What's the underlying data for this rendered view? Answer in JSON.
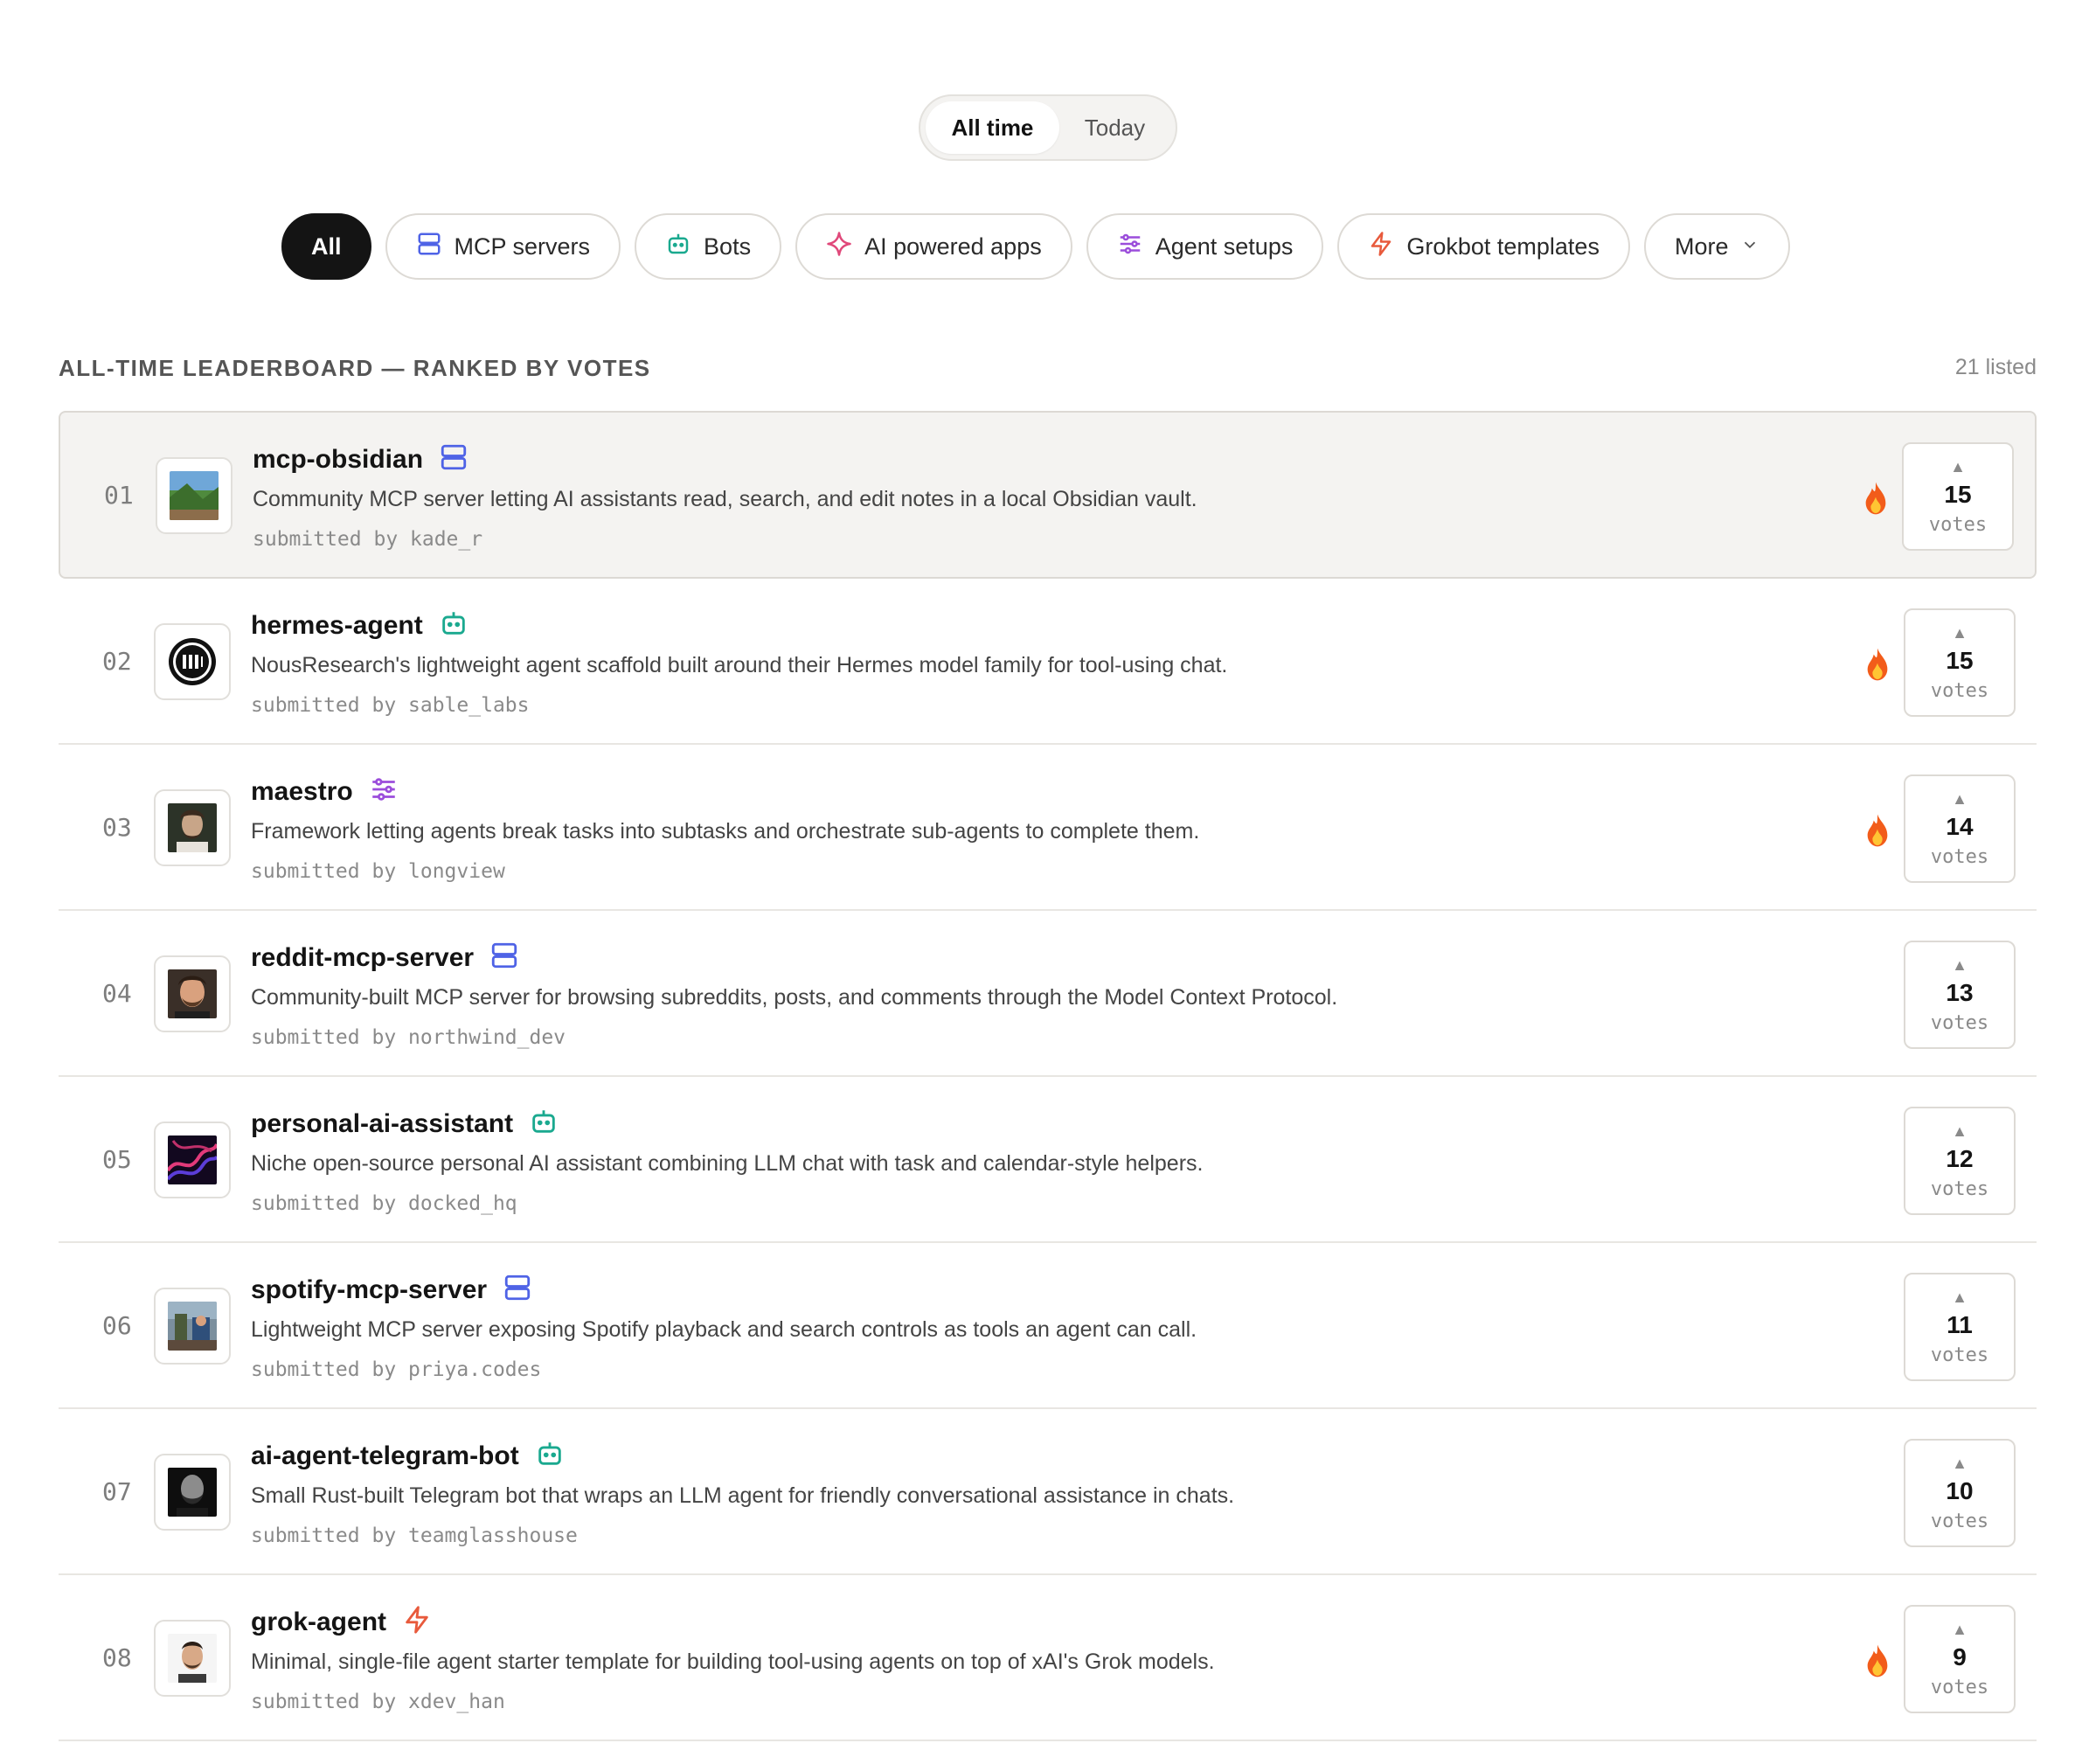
{
  "time_toggle": {
    "options": [
      "All time",
      "Today"
    ],
    "active": "All time"
  },
  "filters": [
    {
      "label": "All",
      "icon": "none",
      "active": true
    },
    {
      "label": "MCP servers",
      "icon": "server-icon"
    },
    {
      "label": "Bots",
      "icon": "bot-icon"
    },
    {
      "label": "AI powered apps",
      "icon": "sparkle-icon"
    },
    {
      "label": "Agent setups",
      "icon": "sliders-icon"
    },
    {
      "label": "Grokbot templates",
      "icon": "bolt-icon"
    },
    {
      "label": "More",
      "icon": "chevron-down-icon"
    }
  ],
  "leaderboard": {
    "title": "ALL-TIME LEADERBOARD — RANKED BY VOTES",
    "count": "21 listed",
    "vote_label": "votes",
    "items": [
      {
        "rank": "01",
        "name": "mcp-obsidian",
        "category_icon": "server-icon",
        "desc": "Community MCP server letting AI assistants read, search, and edit notes in a local Obsidian vault.",
        "by": "submitted by kade_r",
        "votes": "15",
        "hot": true
      },
      {
        "rank": "02",
        "name": "hermes-agent",
        "category_icon": "bot-icon",
        "desc": "NousResearch's lightweight agent scaffold built around their Hermes model family for tool-using chat.",
        "by": "submitted by sable_labs",
        "votes": "15",
        "hot": true
      },
      {
        "rank": "03",
        "name": "maestro",
        "category_icon": "sliders-icon",
        "desc": "Framework letting agents break tasks into subtasks and orchestrate sub-agents to complete them.",
        "by": "submitted by longview",
        "votes": "14",
        "hot": true
      },
      {
        "rank": "04",
        "name": "reddit-mcp-server",
        "category_icon": "server-icon",
        "desc": "Community-built MCP server for browsing subreddits, posts, and comments through the Model Context Protocol.",
        "by": "submitted by northwind_dev",
        "votes": "13",
        "hot": false
      },
      {
        "rank": "05",
        "name": "personal-ai-assistant",
        "category_icon": "bot-icon",
        "desc": "Niche open-source personal AI assistant combining LLM chat with task and calendar-style helpers.",
        "by": "submitted by docked_hq",
        "votes": "12",
        "hot": false
      },
      {
        "rank": "06",
        "name": "spotify-mcp-server",
        "category_icon": "server-icon",
        "desc": "Lightweight MCP server exposing Spotify playback and search controls as tools an agent can call.",
        "by": "submitted by priya.codes",
        "votes": "11",
        "hot": false
      },
      {
        "rank": "07",
        "name": "ai-agent-telegram-bot",
        "category_icon": "bot-icon",
        "desc": "Small Rust-built Telegram bot that wraps an LLM agent for friendly conversational assistance in chats.",
        "by": "submitted by teamglasshouse",
        "votes": "10",
        "hot": false
      },
      {
        "rank": "08",
        "name": "grok-agent",
        "category_icon": "bolt-icon",
        "desc": "Minimal, single-file agent starter template for building tool-using agents on top of xAI's Grok models.",
        "by": "submitted by xdev_han",
        "votes": "9",
        "hot": true
      }
    ]
  },
  "colors": {
    "server": "#4f63e6",
    "bot": "#1aa98f",
    "sparkle": "#e0487a",
    "sliders": "#9b4ddb",
    "bolt": "#e85a3c",
    "fire": "#f25c1a"
  }
}
